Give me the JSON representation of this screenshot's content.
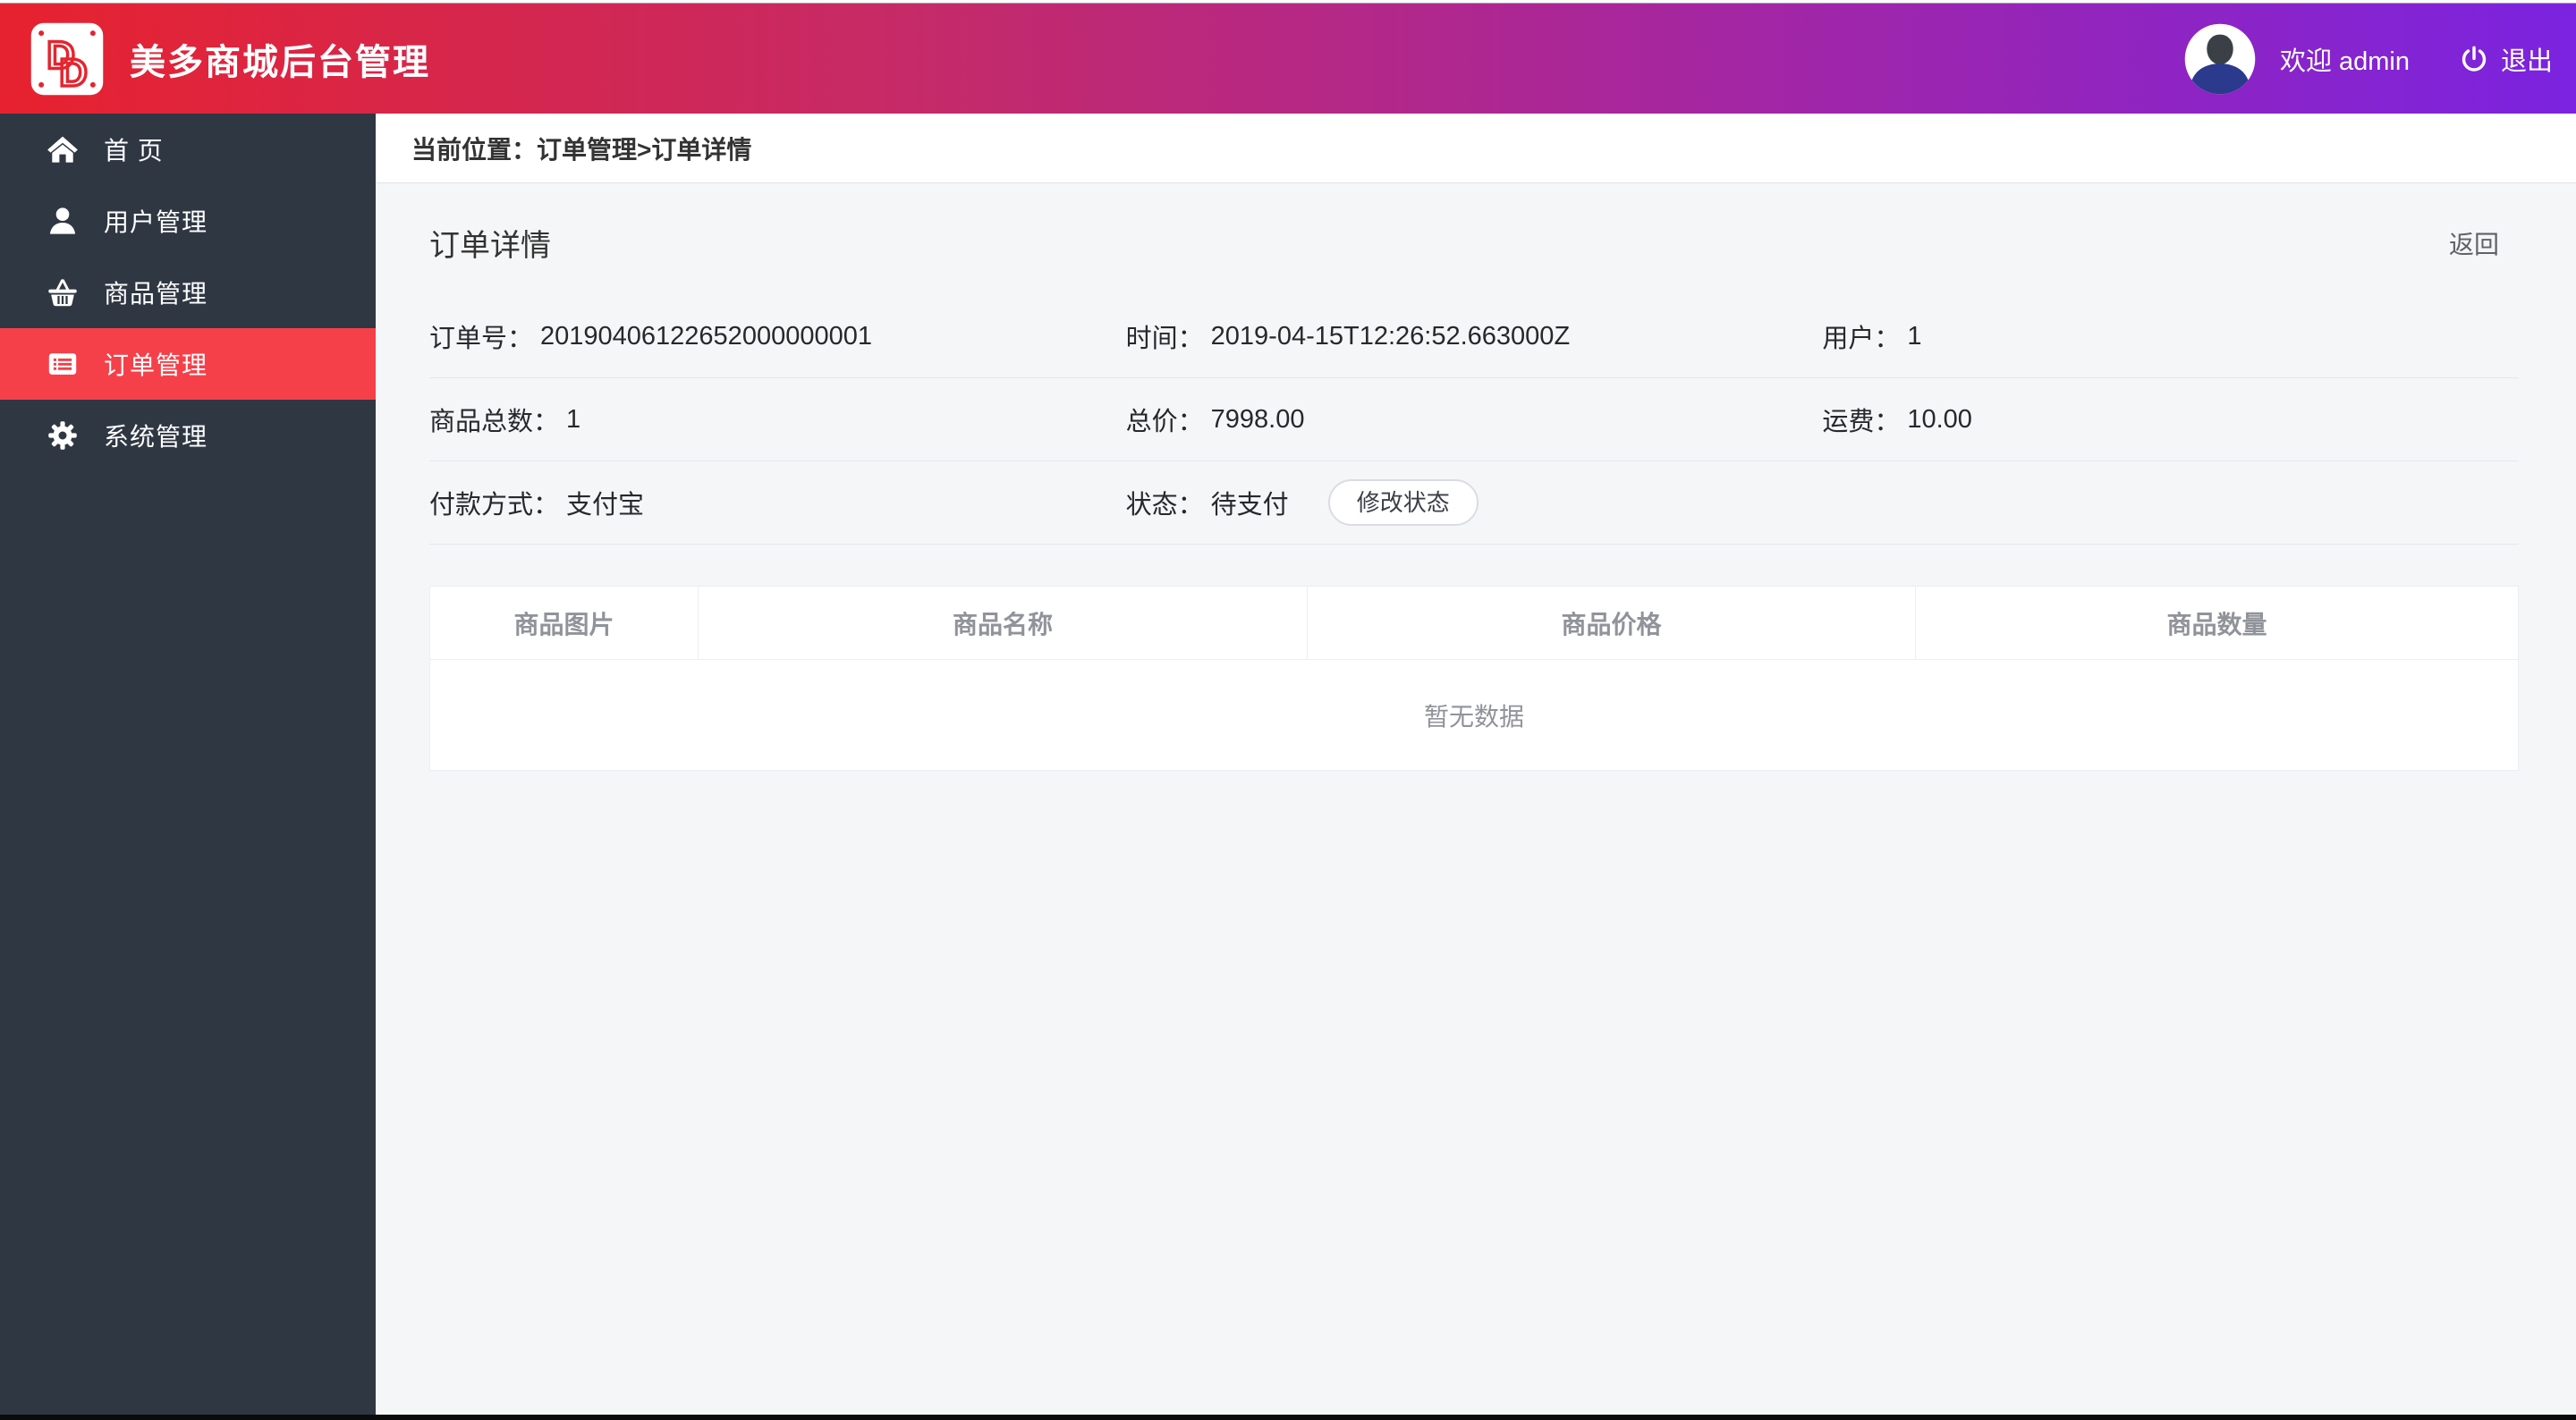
{
  "header": {
    "brand": "美多商城后台管理",
    "welcome": "欢迎 admin",
    "logout": "退出"
  },
  "sidebar": {
    "items": [
      {
        "label": "首 页",
        "icon": "home-icon",
        "active": false
      },
      {
        "label": "用户管理",
        "icon": "user-icon",
        "active": false
      },
      {
        "label": "商品管理",
        "icon": "basket-icon",
        "active": false
      },
      {
        "label": "订单管理",
        "icon": "order-list-icon",
        "active": true
      },
      {
        "label": "系统管理",
        "icon": "gear-icon",
        "active": false
      }
    ]
  },
  "breadcrumb": {
    "text": "当前位置：订单管理>订单详情"
  },
  "page": {
    "title": "订单详情",
    "back_label": "返回"
  },
  "order": {
    "order_no": {
      "label": "订单号：",
      "value": "20190406122652000000001"
    },
    "time": {
      "label": "时间：",
      "value": "2019-04-15T12:26:52.663000Z"
    },
    "user": {
      "label": "用户：",
      "value": "1"
    },
    "total_count": {
      "label": "商品总数：",
      "value": "1"
    },
    "total_price": {
      "label": "总价：",
      "value": "7998.00"
    },
    "freight": {
      "label": "运费：",
      "value": "10.00"
    },
    "pay_method": {
      "label": "付款方式：",
      "value": "支付宝"
    },
    "status": {
      "label": "状态：",
      "value": "待支付",
      "button_label": "修改状态"
    }
  },
  "goods_table": {
    "headers": [
      "商品图片",
      "商品名称",
      "商品价格",
      "商品数量"
    ],
    "rows": [],
    "empty_text": "暂无数据"
  },
  "colors": {
    "header_gradient_start": "#e7222f",
    "header_gradient_end": "#7b23e0",
    "sidebar_bg": "#2f3743",
    "active_item_bg": "#f5404a",
    "content_bg": "#f5f6f7",
    "table_border": "#ebeef5",
    "muted_text": "#909399"
  }
}
